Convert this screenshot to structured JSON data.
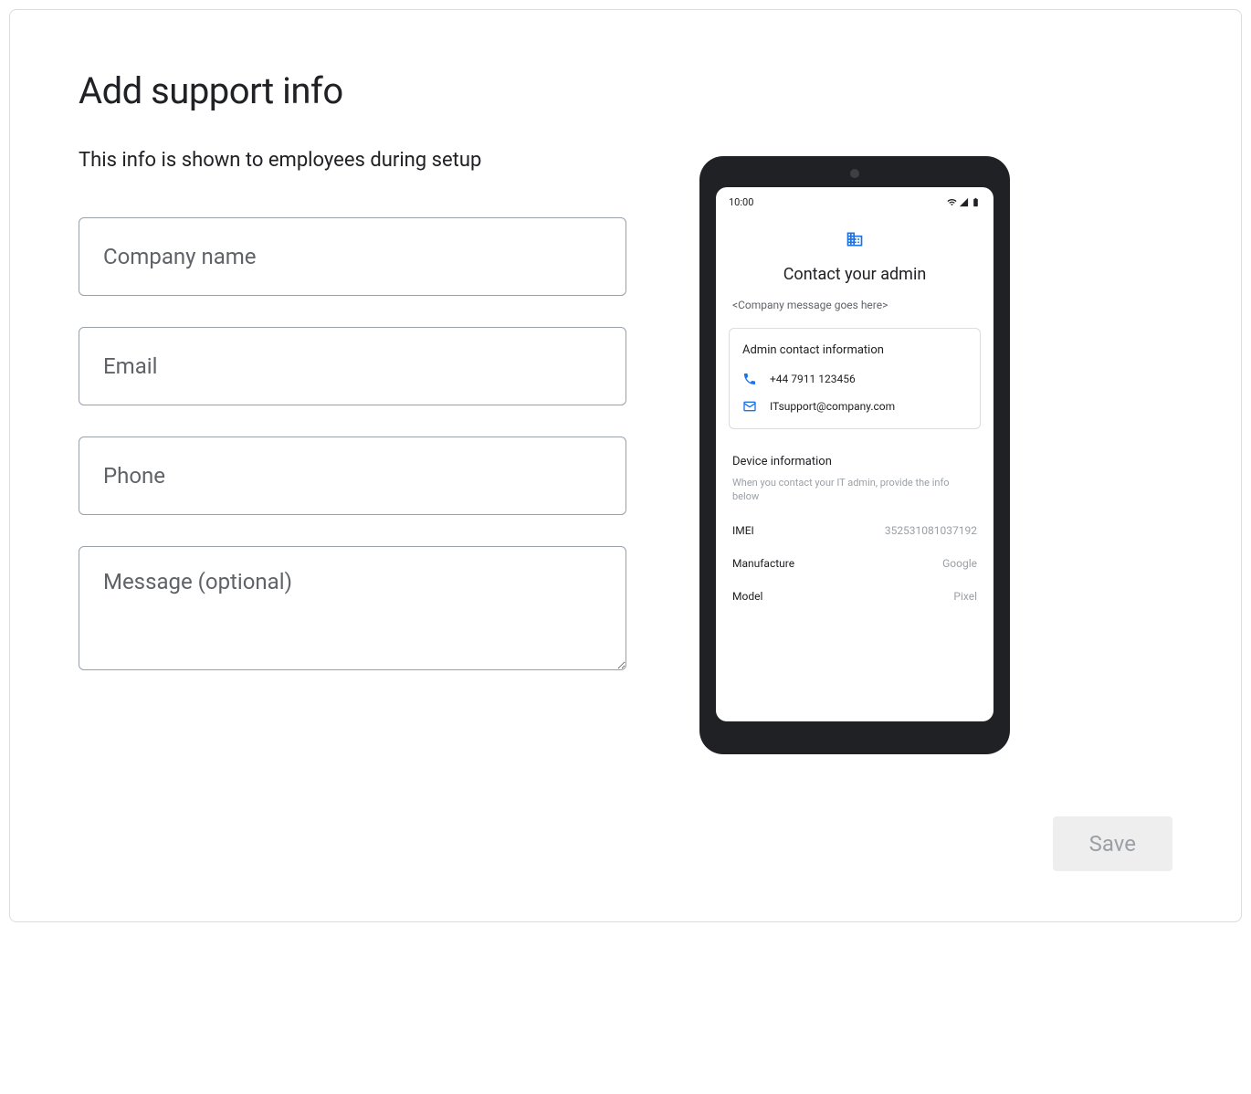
{
  "page": {
    "title": "Add support info",
    "subtitle": "This info is shown to employees during setup"
  },
  "form": {
    "company_placeholder": "Company name",
    "email_placeholder": "Email",
    "phone_placeholder": "Phone",
    "message_placeholder": "Message (optional)",
    "save_label": "Save"
  },
  "preview": {
    "time": "10:00",
    "contact_title": "Contact your admin",
    "company_msg": "<Company message goes here>",
    "admin_card_title": "Admin contact information",
    "phone_value": "+44 7911 123456",
    "email_value": "ITsupport@company.com",
    "device_section_title": "Device information",
    "device_help": "When you contact your IT admin, provide the info below",
    "imei_label": "IMEI",
    "imei_value": "352531081037192",
    "manufacture_label": "Manufacture",
    "manufacture_value": "Google",
    "model_label": "Model",
    "model_value": "Pixel"
  }
}
